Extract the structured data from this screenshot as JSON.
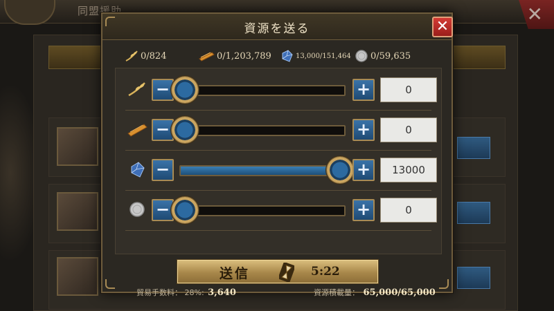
{
  "background": {
    "title": "同盟援助"
  },
  "dialog": {
    "title": "資源を送る",
    "close_symbol": "✕"
  },
  "resources": [
    {
      "icon": "wheat-icon",
      "label": "0/824"
    },
    {
      "icon": "wood-plank-icon",
      "label": "0/1,203,789"
    },
    {
      "icon": "blue-crystal-icon",
      "label": "13,000/151,464"
    },
    {
      "icon": "silver-coin-icon",
      "label": "0/59,635"
    }
  ],
  "sliders": [
    {
      "icon": "wheat-icon",
      "value": "0",
      "fraction": 0.0
    },
    {
      "icon": "wood-plank-icon",
      "value": "0",
      "fraction": 0.0
    },
    {
      "icon": "blue-crystal-icon",
      "value": "13000",
      "fraction": 1.0
    },
    {
      "icon": "silver-coin-icon",
      "value": "0",
      "fraction": 0.0
    }
  ],
  "buttons": {
    "minus": "−",
    "plus": "+"
  },
  "fee": {
    "label": "貿易手数料：",
    "rate": "28%:",
    "amount": "3,640"
  },
  "capacity": {
    "label": "資源積載量：",
    "value": "65,000/65,000"
  },
  "send": {
    "label": "送信",
    "time": "5:22"
  },
  "colors": {
    "accent_gold": "#caa560",
    "button_blue": "#2f6596",
    "close_red": "#c0302a"
  }
}
